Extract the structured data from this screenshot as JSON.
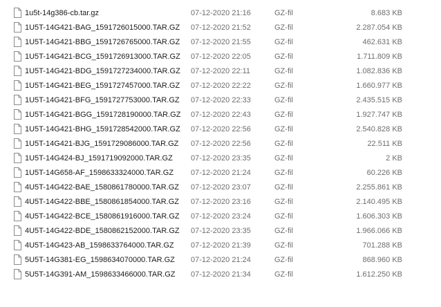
{
  "file_icon": "document-icon",
  "files": [
    {
      "name": "1u5t-14g386-cb.tar.gz",
      "modified": "07-12-2020 21:16",
      "type": "GZ-fil",
      "size": "8.683 KB"
    },
    {
      "name": "1U5T-14G421-BAG_1591726015000.TAR.GZ",
      "modified": "07-12-2020 21:52",
      "type": "GZ-fil",
      "size": "2.287.054 KB"
    },
    {
      "name": "1U5T-14G421-BBG_1591726765000.TAR.GZ",
      "modified": "07-12-2020 21:55",
      "type": "GZ-fil",
      "size": "462.631 KB"
    },
    {
      "name": "1U5T-14G421-BCG_1591726913000.TAR.GZ",
      "modified": "07-12-2020 22:05",
      "type": "GZ-fil",
      "size": "1.711.809 KB"
    },
    {
      "name": "1U5T-14G421-BDG_1591727234000.TAR.GZ",
      "modified": "07-12-2020 22:11",
      "type": "GZ-fil",
      "size": "1.082.836 KB"
    },
    {
      "name": "1U5T-14G421-BEG_1591727457000.TAR.GZ",
      "modified": "07-12-2020 22:22",
      "type": "GZ-fil",
      "size": "1.660.977 KB"
    },
    {
      "name": "1U5T-14G421-BFG_1591727753000.TAR.GZ",
      "modified": "07-12-2020 22:33",
      "type": "GZ-fil",
      "size": "2.435.515 KB"
    },
    {
      "name": "1U5T-14G421-BGG_1591728190000.TAR.GZ",
      "modified": "07-12-2020 22:43",
      "type": "GZ-fil",
      "size": "1.927.747 KB"
    },
    {
      "name": "1U5T-14G421-BHG_1591728542000.TAR.GZ",
      "modified": "07-12-2020 22:56",
      "type": "GZ-fil",
      "size": "2.540.828 KB"
    },
    {
      "name": "1U5T-14G421-BJG_1591729086000.TAR.GZ",
      "modified": "07-12-2020 22:56",
      "type": "GZ-fil",
      "size": "22.511 KB"
    },
    {
      "name": "1U5T-14G424-BJ_1591719092000.TAR.GZ",
      "modified": "07-12-2020 23:35",
      "type": "GZ-fil",
      "size": "2 KB"
    },
    {
      "name": "1U5T-14G658-AF_1598633324000.TAR.GZ",
      "modified": "07-12-2020 21:24",
      "type": "GZ-fil",
      "size": "60.226 KB"
    },
    {
      "name": "4U5T-14G422-BAE_1580861780000.TAR.GZ",
      "modified": "07-12-2020 23:07",
      "type": "GZ-fil",
      "size": "2.255.861 KB"
    },
    {
      "name": "4U5T-14G422-BBE_1580861854000.TAR.GZ",
      "modified": "07-12-2020 23:16",
      "type": "GZ-fil",
      "size": "2.140.495 KB"
    },
    {
      "name": "4U5T-14G422-BCE_1580861916000.TAR.GZ",
      "modified": "07-12-2020 23:24",
      "type": "GZ-fil",
      "size": "1.606.303 KB"
    },
    {
      "name": "4U5T-14G422-BDE_1580862152000.TAR.GZ",
      "modified": "07-12-2020 23:35",
      "type": "GZ-fil",
      "size": "1.966.066 KB"
    },
    {
      "name": "4U5T-14G423-AB_1598633764000.TAR.GZ",
      "modified": "07-12-2020 21:39",
      "type": "GZ-fil",
      "size": "701.288 KB"
    },
    {
      "name": "5U5T-14G381-EG_1598634070000.TAR.GZ",
      "modified": "07-12-2020 21:24",
      "type": "GZ-fil",
      "size": "868.960 KB"
    },
    {
      "name": "5U5T-14G391-AM_1598633466000.TAR.GZ",
      "modified": "07-12-2020 21:34",
      "type": "GZ-fil",
      "size": "1.612.250 KB"
    }
  ]
}
